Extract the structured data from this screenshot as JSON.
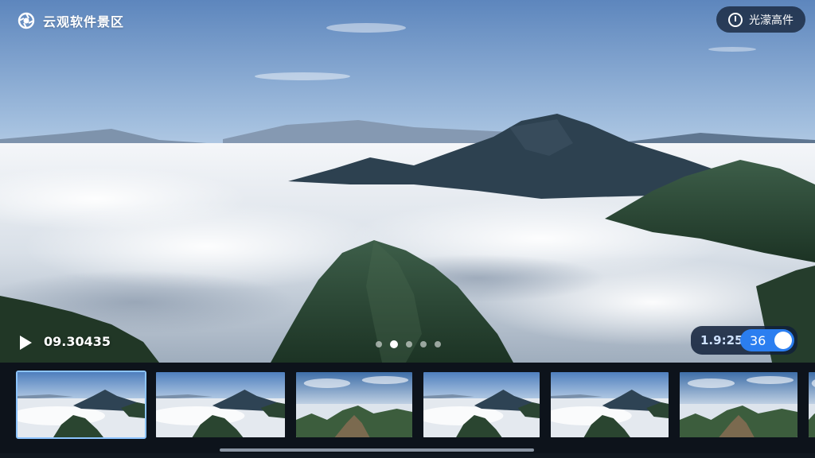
{
  "header": {
    "title": "云观软件景区",
    "action_label": "光濛高件",
    "logo_icon": "aperture-icon",
    "action_icon": "info-circle-icon"
  },
  "player": {
    "time": "09.30435",
    "play_icon": "play-icon",
    "carousel": {
      "count": 5,
      "active_index": 1
    },
    "control": {
      "value": "1.9:25",
      "toggle_value": "36",
      "toggle_on": true,
      "accent": "#2b7ef0"
    }
  },
  "thumbnails": [
    {
      "id": "thumb-1",
      "selected": true,
      "variant": "peak"
    },
    {
      "id": "thumb-2",
      "selected": false,
      "variant": "peak"
    },
    {
      "id": "thumb-3",
      "selected": false,
      "variant": "valley"
    },
    {
      "id": "thumb-4",
      "selected": false,
      "variant": "peak"
    },
    {
      "id": "thumb-5",
      "selected": false,
      "variant": "peak"
    },
    {
      "id": "thumb-6",
      "selected": false,
      "variant": "valley"
    },
    {
      "id": "thumb-7",
      "selected": false,
      "variant": "valley"
    }
  ]
}
